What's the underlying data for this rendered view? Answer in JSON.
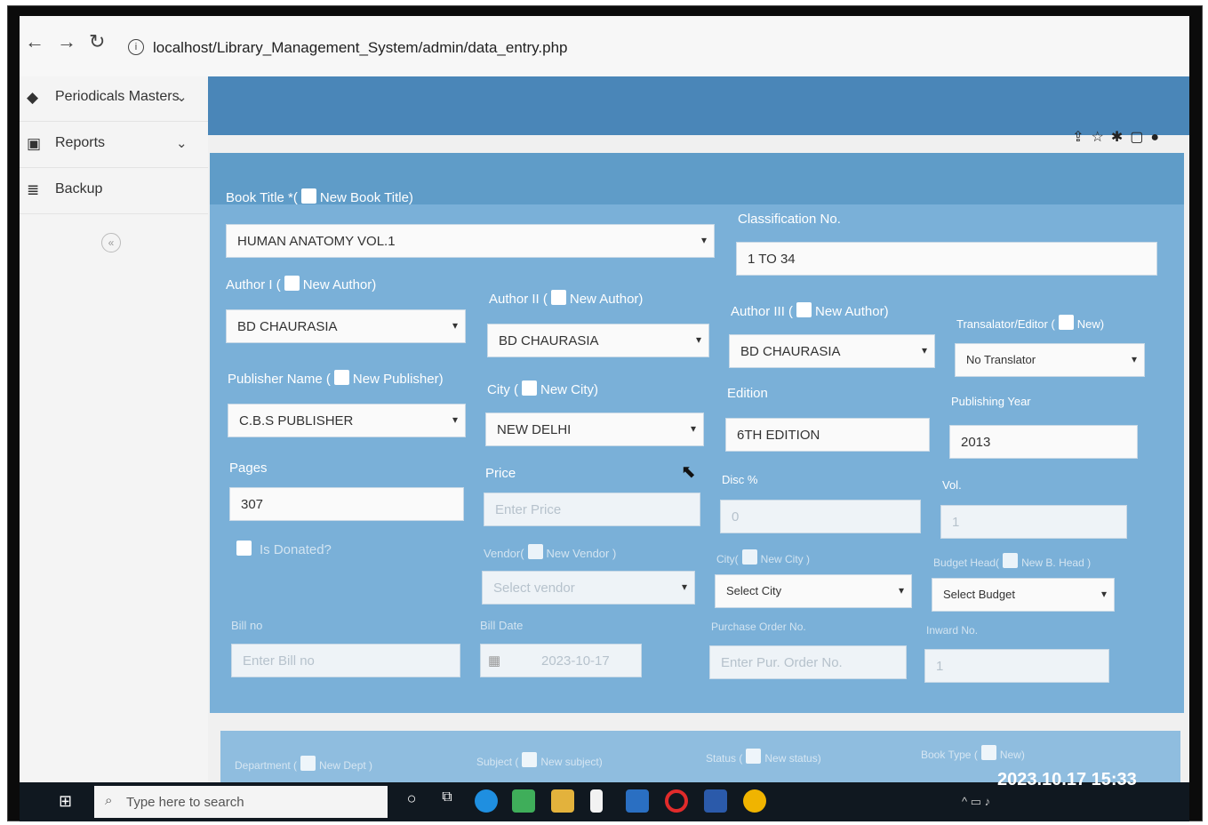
{
  "browser": {
    "url": "localhost/Library_Management_System/admin/data_entry.php"
  },
  "sidebar": {
    "items": [
      {
        "label": "Periodicals Masters"
      },
      {
        "label": "Reports"
      },
      {
        "label": "Backup"
      }
    ],
    "collapse_glyph": "«"
  },
  "form": {
    "book_title": {
      "label": "Book Title *(",
      "new_label": "New Book Title)",
      "value": "HUMAN ANATOMY VOL.1"
    },
    "classification": {
      "label": "Classification No.",
      "value": "1 TO 34"
    },
    "author1": {
      "label": "Author I (",
      "new_label": "New Author)",
      "value": "BD CHAURASIA"
    },
    "author2": {
      "label": "Author II (",
      "new_label": "New Author)",
      "value": "BD CHAURASIA"
    },
    "author3": {
      "label": "Author III (",
      "new_label": "New Author)",
      "value": "BD CHAURASIA"
    },
    "translator": {
      "label": "Transalator/Editor (",
      "new_label": "New)",
      "value": "No Translator"
    },
    "publisher": {
      "label": "Publisher Name (",
      "new_label": "New Publisher)",
      "value": "C.B.S PUBLISHER"
    },
    "city": {
      "label": "City (",
      "new_label": "New City)",
      "value": "NEW DELHI"
    },
    "edition": {
      "label": "Edition",
      "value": "6TH EDITION"
    },
    "publishing_year": {
      "label": "Publishing Year",
      "value": "2013"
    },
    "pages": {
      "label": "Pages",
      "value": "307"
    },
    "price": {
      "label": "Price",
      "placeholder": "Enter Price"
    },
    "disc": {
      "label": "Disc %",
      "value": "0"
    },
    "vol": {
      "label": "Vol.",
      "value": "1"
    },
    "donated": {
      "label": "Is Donated?"
    },
    "vendor": {
      "label": "Vendor(",
      "new_label": "New Vendor )",
      "value": "Select vendor"
    },
    "city2": {
      "label": "City(",
      "new_label": "New City )",
      "value": "Select City"
    },
    "budget": {
      "label": "Budget Head(",
      "new_label": "New B. Head )",
      "value": "Select Budget"
    },
    "bill_no": {
      "label": "Bill no",
      "placeholder": "Enter Bill no"
    },
    "bill_date": {
      "label": "Bill Date",
      "value": "2023-10-17"
    },
    "po_no": {
      "label": "Purchase Order No.",
      "placeholder": "Enter Pur. Order No."
    },
    "inward_no": {
      "label": "Inward No.",
      "value": "1"
    },
    "department": {
      "label": "Department (",
      "new_label": "New Dept )"
    },
    "subject": {
      "label": "Subject (",
      "new_label": "New subject)"
    },
    "status": {
      "label": "Status (",
      "new_label": "New status)"
    },
    "book_type": {
      "label": "Book Type (",
      "new_label": "New)"
    }
  },
  "taskbar": {
    "search_placeholder": "Type here to search"
  },
  "timestamp": "2023.10.17 15:33",
  "colors": {
    "accent": "#4a86b8",
    "panel": "#7ab0d8"
  }
}
